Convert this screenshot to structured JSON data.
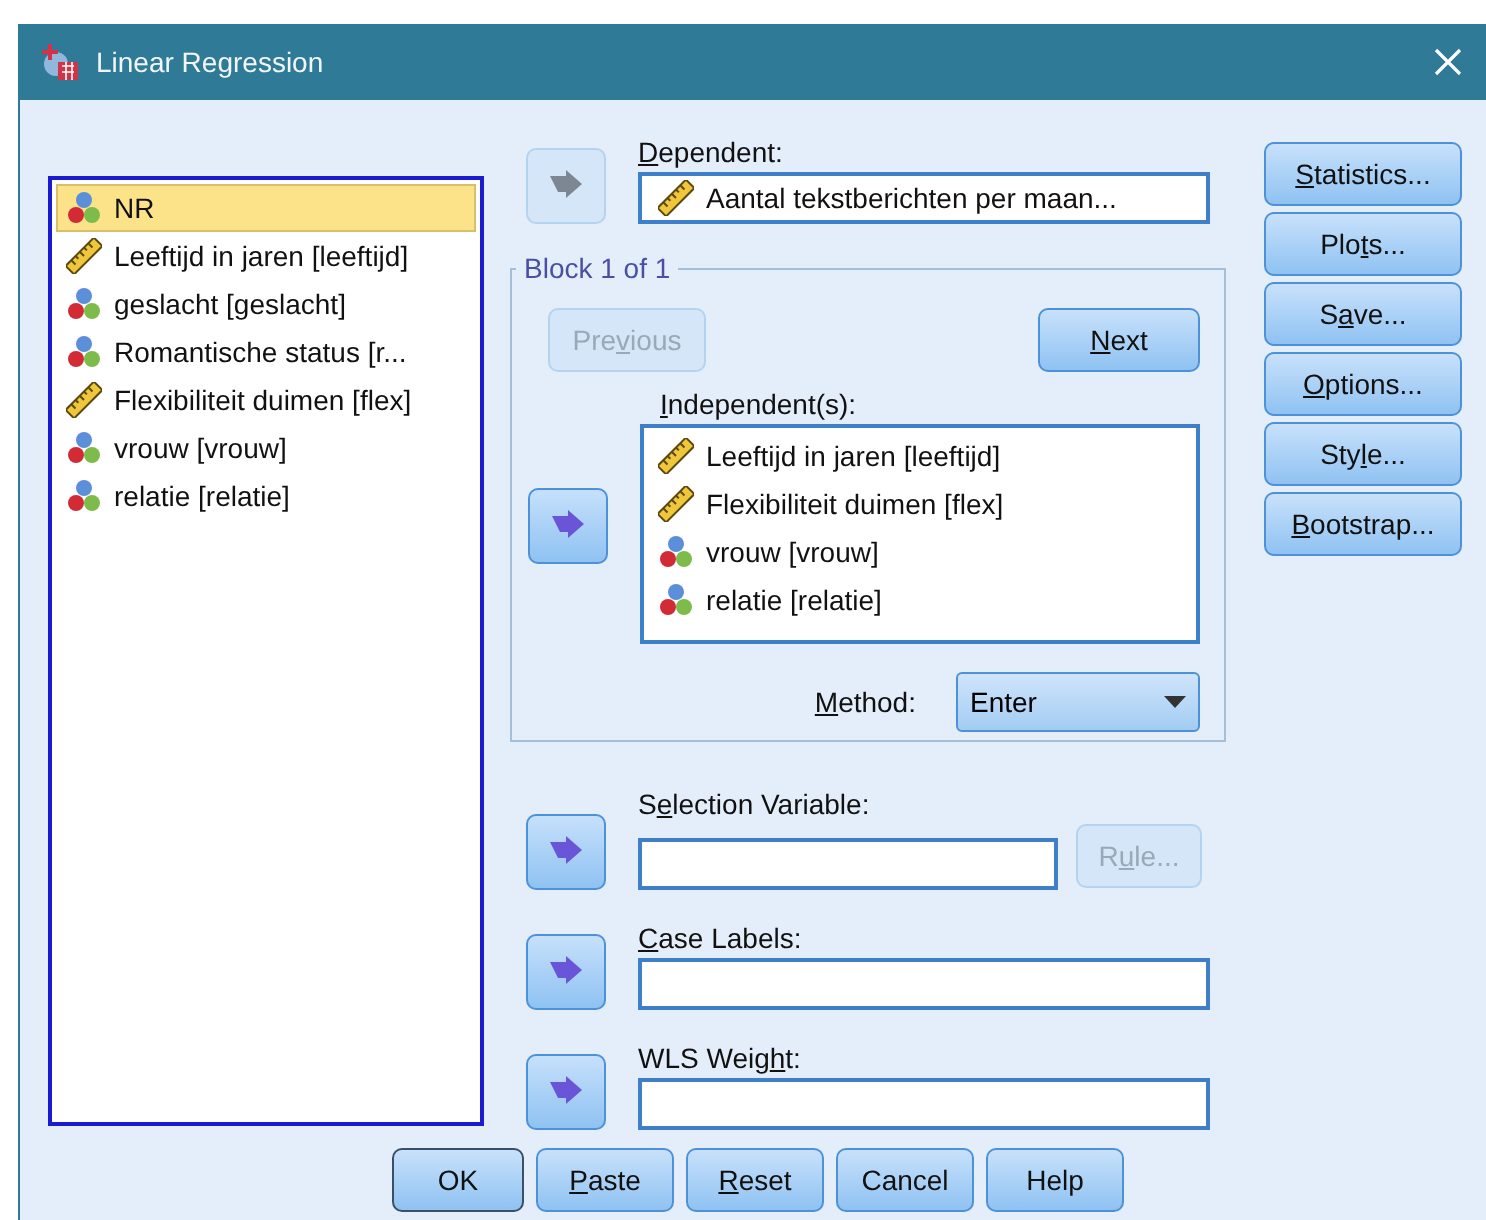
{
  "window": {
    "title": "Linear Regression"
  },
  "variables": [
    {
      "name": "NR",
      "kind": "nominal",
      "selected": true
    },
    {
      "name": "Leeftijd in jaren [leeftijd]",
      "kind": "scale",
      "selected": false
    },
    {
      "name": "geslacht [geslacht]",
      "kind": "nominal",
      "selected": false
    },
    {
      "name": "Romantische status [r...",
      "kind": "nominal",
      "selected": false
    },
    {
      "name": "Flexibiliteit duimen [flex]",
      "kind": "scale",
      "selected": false
    },
    {
      "name": "vrouw [vrouw]",
      "kind": "nominal",
      "selected": false
    },
    {
      "name": "relatie [relatie]",
      "kind": "nominal",
      "selected": false
    }
  ],
  "dependent": {
    "label": {
      "key": "D",
      "post": "ependent:"
    },
    "arrow_disabled": true,
    "value": {
      "kind": "scale",
      "text": "Aantal tekstberichten per maan..."
    }
  },
  "block": {
    "title": "Block 1 of 1",
    "previous": {
      "label": {
        "pre": "Pre",
        "key": "v",
        "post": "ious"
      },
      "disabled": true
    },
    "next": {
      "label": {
        "key": "N",
        "post": "ext"
      },
      "disabled": false
    },
    "independents": {
      "label": {
        "key": "I",
        "post": "ndependent(s):"
      },
      "arrow_disabled": false,
      "items": [
        {
          "name": "Leeftijd in jaren [leeftijd]",
          "kind": "scale",
          "selected": false
        },
        {
          "name": "Flexibiliteit duimen [flex]",
          "kind": "scale",
          "selected": false
        },
        {
          "name": "vrouw [vrouw]",
          "kind": "nominal",
          "selected": false
        },
        {
          "name": "relatie [relatie]",
          "kind": "nominal",
          "selected": false
        }
      ]
    },
    "method": {
      "label": {
        "key": "M",
        "post": "ethod:"
      },
      "value": "Enter"
    }
  },
  "selection_variable": {
    "label": {
      "pre": "S",
      "key": "e",
      "post": "lection Variable:"
    },
    "arrow_disabled": false,
    "rule": {
      "label": {
        "pre": "R",
        "key": "u",
        "post": "le..."
      },
      "disabled": true
    }
  },
  "case_labels": {
    "label": {
      "key": "C",
      "post": "ase Labels:"
    },
    "arrow_disabled": false
  },
  "wls_weight": {
    "label": {
      "pre": "WLS Weig",
      "key": "h",
      "post": "t:"
    },
    "arrow_disabled": false
  },
  "side_buttons": [
    {
      "label": {
        "key": "S",
        "post": "tatistics..."
      },
      "disabled": false
    },
    {
      "label": {
        "pre": "Plo",
        "key": "t",
        "post": "s..."
      },
      "disabled": false
    },
    {
      "label": {
        "pre": "S",
        "key": "a",
        "post": "ve..."
      },
      "disabled": false
    },
    {
      "label": {
        "key": "O",
        "post": "ptions..."
      },
      "disabled": false
    },
    {
      "label": {
        "pre": "Sty",
        "key": "l",
        "post": "e..."
      },
      "disabled": false
    },
    {
      "label": {
        "key": "B",
        "post": "ootstrap..."
      },
      "disabled": false
    }
  ],
  "action_buttons": [
    {
      "label": "OK",
      "default": true
    },
    {
      "label": {
        "key": "P",
        "post": "aste"
      },
      "default": false
    },
    {
      "label": {
        "key": "R",
        "post": "eset"
      },
      "default": false
    },
    {
      "label": "Cancel",
      "default": false
    },
    {
      "label": "Help",
      "default": false
    }
  ]
}
